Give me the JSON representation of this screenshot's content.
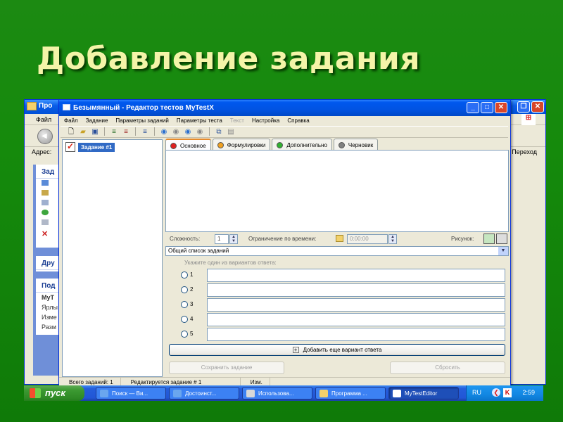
{
  "slide": {
    "title": "Добавление задания"
  },
  "background_window": {
    "title": "Про",
    "menu": "Файл",
    "address_label": "Адрес:",
    "goto_label": "Переход",
    "side_panels": [
      {
        "title": "Зад",
        "items": [
          "",
          "",
          "",
          "",
          "",
          ""
        ]
      },
      {
        "title": "Дру",
        "items": []
      },
      {
        "title": "Под",
        "items": [
          "MyT",
          "Ярлы",
          "Изме",
          "Разм"
        ]
      }
    ]
  },
  "editor_window": {
    "title": "Безымянный - Редактор тестов MyTestX",
    "menu": [
      {
        "label": "Файл",
        "enabled": true
      },
      {
        "label": "Задание",
        "enabled": true
      },
      {
        "label": "Параметры заданий",
        "enabled": true
      },
      {
        "label": "Параметры теста",
        "enabled": true
      },
      {
        "label": "Текст",
        "enabled": false
      },
      {
        "label": "Настройка",
        "enabled": true
      },
      {
        "label": "Справка",
        "enabled": true
      }
    ],
    "toolbar_icons": [
      "new-file-icon",
      "open-folder-icon",
      "save-icon",
      "add-task-icon",
      "delete-task-icon",
      "task-list-icon",
      "nav-up-icon",
      "nav-down-icon",
      "nav-next-icon",
      "nav-prev-icon",
      "copy-icon",
      "paste-icon"
    ],
    "tree": {
      "items": [
        {
          "label": "Задание #1",
          "selected": true
        }
      ]
    },
    "tabs": [
      {
        "label": "Основное",
        "color": "#e02020",
        "active": true
      },
      {
        "label": "Формулировки",
        "color": "#f0a020",
        "active": false
      },
      {
        "label": "Дополнительно",
        "color": "#30b030",
        "active": false
      },
      {
        "label": "Черновик",
        "color": "#808080",
        "active": false
      }
    ],
    "params": {
      "difficulty_label": "Сложность:",
      "difficulty_value": "1",
      "time_limit_label": "Ограничение по времени:",
      "time_limit_value": "0:00:00",
      "picture_label": "Рисунок:"
    },
    "task_list_combo": {
      "value": "Общий список заданий"
    },
    "answers": {
      "hint": "Укажите один из вариантов ответа:",
      "options": [
        {
          "number": "1",
          "text": ""
        },
        {
          "number": "2",
          "text": ""
        },
        {
          "number": "3",
          "text": ""
        },
        {
          "number": "4",
          "text": ""
        },
        {
          "number": "5",
          "text": ""
        }
      ],
      "add_button": "Добавить еще вариант ответа",
      "save_button": "Сохранить задание",
      "reset_button": "Сбросить"
    },
    "status": {
      "total": "Всего заданий: 1",
      "editing": "Редактируется задание # 1",
      "modified": "Изм."
    }
  },
  "taskbar": {
    "start_label": "пуск",
    "tasks": [
      {
        "label": "Поиск — Ви...",
        "active": false
      },
      {
        "label": "Достоинст...",
        "active": false
      },
      {
        "label": "Использова...",
        "active": false
      },
      {
        "label": "Программа ...",
        "active": false
      },
      {
        "label": "MyTestEditor",
        "active": true
      }
    ],
    "lang": "RU",
    "clock": "2:59"
  }
}
